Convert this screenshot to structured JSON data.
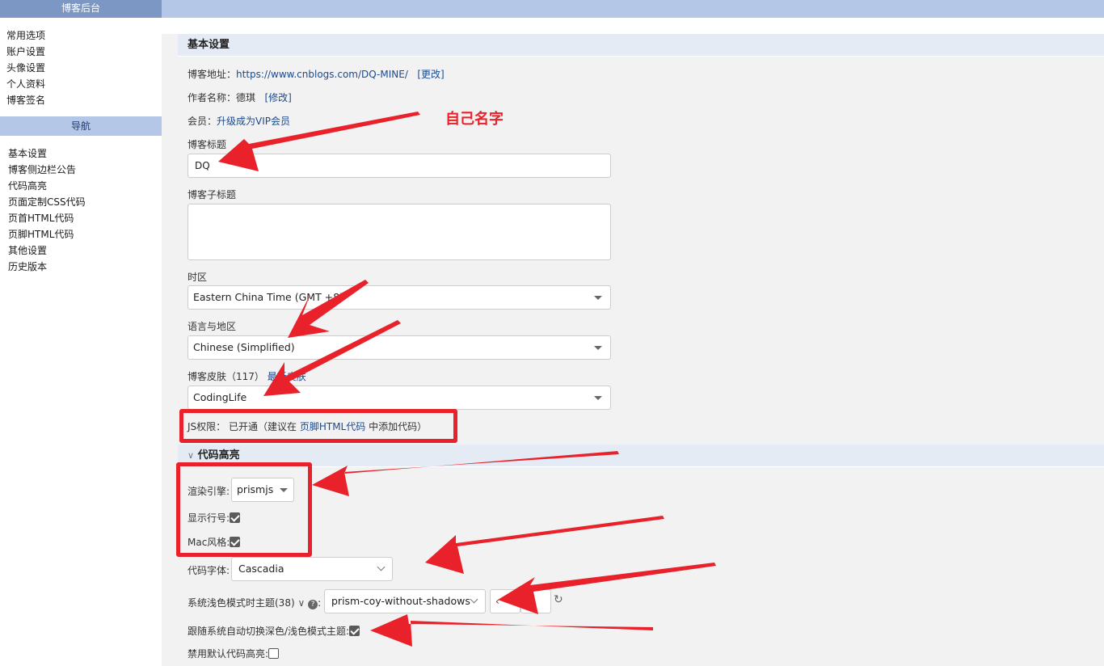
{
  "sidebar": {
    "header": "博客后台",
    "top_items": [
      "常用选项",
      "账户设置",
      "头像设置",
      "个人资料",
      "博客签名"
    ],
    "nav_title": "导航",
    "nav_items": [
      "基本设置",
      "博客侧边栏公告",
      "代码高亮",
      "页面定制CSS代码",
      "页首HTML代码",
      "页脚HTML代码",
      "其他设置",
      "历史版本"
    ]
  },
  "basic": {
    "title": "基本设置",
    "blog_address_label": "博客地址：",
    "blog_address_url": "https://www.cnblogs.com/DQ-MINE/",
    "change_link": "[更改]",
    "author_label": "作者名称：",
    "author_name": "德琪",
    "modify_link": "[修改]",
    "member_label": "会员：",
    "member_link": "升级成为VIP会员",
    "blog_title_label": "博客标题",
    "blog_title_value": "DQ",
    "subtitle_label": "博客子标题",
    "timezone_label": "时区",
    "timezone_value": "Eastern China Time (GMT +8)",
    "language_label": "语言与地区",
    "language_value": "Chinese (Simplified)",
    "skin_label": "博客皮肤（117）",
    "skin_link": "最新皮肤",
    "skin_value": "CodingLife",
    "js_label": "JS权限：",
    "js_status": "已开通（建议在",
    "js_link": "页脚HTML代码",
    "js_suffix": "中添加代码）"
  },
  "code": {
    "title": "代码高亮",
    "engine_label": "渲染引擎:",
    "engine_value": "prismjs",
    "line_numbers_label": "显示行号:",
    "line_numbers_checked": true,
    "mac_label": "Mac风格:",
    "mac_checked": true,
    "font_label": "代码字体:",
    "font_value": "Cascadia",
    "light_theme_label": "系统浅色模式时主题(38)",
    "light_theme_value": "prism-coy-without-shadows",
    "auto_switch_label": "跟随系统自动切换深色/浅色模式主题:",
    "auto_switch_checked": true,
    "disable_label": "禁用默认代码高亮:",
    "disable_checked": false
  },
  "annotation": {
    "text": "自己名字",
    "color": "#e8212a"
  }
}
